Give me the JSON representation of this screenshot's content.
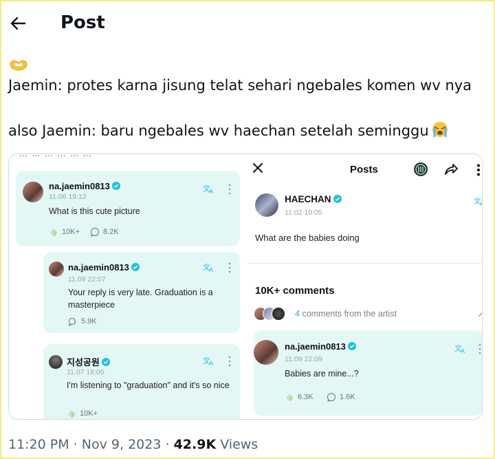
{
  "header": {
    "title": "Post"
  },
  "tweet": {
    "line1": "Jaemin: protes karna jisung telat sehari ngebales komen wv nya",
    "line2": "also Jaemin: baru ngebales wv haechan setelah seminggu"
  },
  "media": {
    "cut_text": "… … … … … …",
    "left": {
      "comments": [
        {
          "username": "na.jaemin0813",
          "timestamp": "11.06 19:12",
          "text": "What is this cute picture",
          "likes": "10K+",
          "replies": "8.2K"
        },
        {
          "username": "na.jaemin0813",
          "timestamp": "11.09 22:07",
          "text": "Your reply is very late. Graduation is a masterpiece",
          "replies": "5.9K"
        },
        {
          "username": "지성공원",
          "timestamp": "11.07 18:05",
          "text": "I'm listening to \"graduation\" and it's so nice",
          "likes": "10K+"
        }
      ]
    },
    "right": {
      "title": "Posts",
      "post": {
        "username": "HAECHAN",
        "timestamp": "11.02 10:05",
        "text": "What are the babies doing"
      },
      "comments_header": "10K+ comments",
      "artist_note_count": "4",
      "artist_note_text": "comments from the artist",
      "reply": {
        "username": "na.jaemin0813",
        "timestamp": "11.09 22:09",
        "text": "Babies are mine...?",
        "likes": "6.3K",
        "replies": "1.6K"
      }
    }
  },
  "footer": {
    "time": "11:20 PM",
    "sep1": " · ",
    "date": "Nov 9, 2023",
    "sep2": " · ",
    "views": "42.9K",
    "views_label": " Views"
  },
  "colors": {
    "card_bg": "#e3f8f5",
    "accent": "#2fb3c6",
    "verified": "#22c0d8"
  }
}
